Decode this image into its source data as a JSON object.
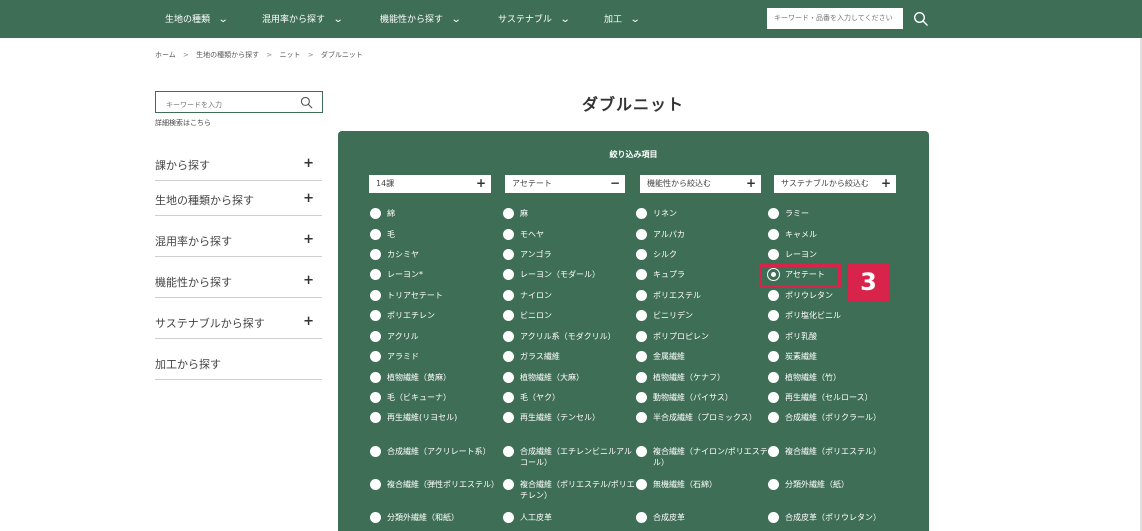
{
  "nav": {
    "items": [
      {
        "label": "生地の種類"
      },
      {
        "label": "混用率から探す"
      },
      {
        "label": "機能性から探す"
      },
      {
        "label": "サステナブル"
      },
      {
        "label": "加工"
      }
    ],
    "search_placeholder": "キーワード・品番を入力してください"
  },
  "breadcrumb": [
    "ホーム",
    "生地の種類から探す",
    "ニット",
    "ダブルニット"
  ],
  "breadcrumb_sep": ">",
  "sidebar": {
    "search_placeholder": "キーワードを入力",
    "advanced_link": "詳細検索はこちら",
    "items": [
      {
        "label": "課から探す",
        "expand": "+"
      },
      {
        "label": "生地の種類から探す",
        "expand": "+"
      },
      {
        "label": "混用率から探す",
        "expand": "+"
      },
      {
        "label": "機能性から探す",
        "expand": "+"
      },
      {
        "label": "サステナブルから探す",
        "expand": "+"
      },
      {
        "label": "加工から探す",
        "expand": ""
      }
    ]
  },
  "main": {
    "title": "ダブルニット",
    "filter_heading": "絞り込み項目",
    "dropdowns": [
      {
        "label": "14課",
        "toggle": "+"
      },
      {
        "label": "アセテート",
        "toggle": "−"
      },
      {
        "label": "機能性から絞込む",
        "toggle": "+"
      },
      {
        "label": "サステナブルから絞込む",
        "toggle": "+"
      }
    ],
    "options": [
      "綿",
      "麻",
      "リネン",
      "ラミー",
      "毛",
      "モヘヤ",
      "アルパカ",
      "キャメル",
      "カシミヤ",
      "アンゴラ",
      "シルク",
      "レーヨン",
      "レーヨン*",
      "レーヨン（モダール）",
      "キュプラ",
      "アセテート",
      "トリアセテート",
      "ナイロン",
      "ポリエステル",
      "ポリウレタン",
      "ポリエチレン",
      "ビニロン",
      "ビニリデン",
      "ポリ塩化ビニル",
      "アクリル",
      "アクリル系（モダクリル）",
      "ポリプロピレン",
      "ポリ乳酸",
      "アラミド",
      "ガラス繊維",
      "金属繊維",
      "炭素繊維",
      "植物繊維（黄麻）",
      "植物繊維（大麻）",
      "植物繊維（ケナフ）",
      "植物繊維（竹）",
      "毛（ビキューナ）",
      "毛（ヤク）",
      "動物繊維（パイサス）",
      "再生繊維（セルロース）",
      "再生繊維(リヨセル)",
      "再生繊維（テンセル）",
      "半合成繊維（プロミックス）",
      "合成繊維（ポリクラール）",
      "合成繊維（アクリレート系）",
      "合成繊維（エチレンビニルアルコール）",
      "複合繊維（ナイロン/ポリエステル）",
      "複合繊維（ポリエステル）",
      "複合繊維（弾性ポリエステル）",
      "複合繊維（ポリエステル/ポリエチレン）",
      "無機繊維（石綿）",
      "分類外繊維（紙）",
      "分類外繊維（和紙）",
      "人工皮革",
      "合成皮革",
      "合成皮革（ポリウレタン）"
    ],
    "selected_option": "アセテート"
  },
  "annotation": {
    "step": "3",
    "color": "#d8234a"
  },
  "colors": {
    "brand": "#3f6e56",
    "accent": "#d8234a"
  }
}
